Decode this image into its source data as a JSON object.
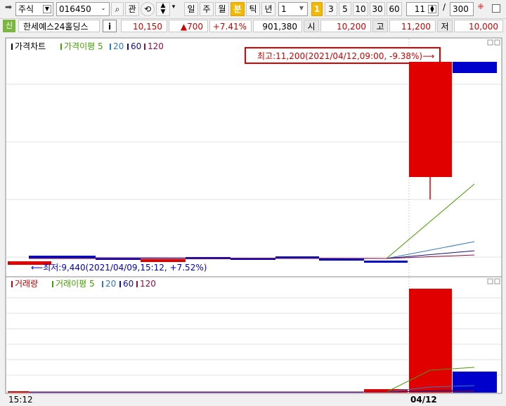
{
  "toolbar": {
    "market_type": "주식",
    "code": "016450",
    "btn_watch": "관",
    "periods": [
      "일",
      "주",
      "월",
      "분",
      "틱",
      "년"
    ],
    "selected_period": "분",
    "interval": "1",
    "intervals": [
      "1",
      "3",
      "5",
      "10",
      "30",
      "60"
    ],
    "selected_interval": "1",
    "zoom_value": "11",
    "zoom_sep": "/",
    "zoom_total": "300"
  },
  "quote": {
    "badge": "신",
    "name": "한세예스24홀딩스",
    "info_btn": "i",
    "price": "10,150",
    "change": "▲700",
    "change_pct": "+7.41%",
    "volume": "901,380",
    "open_label": "시",
    "open": "10,200",
    "high_label": "고",
    "high": "11,200",
    "low_label": "저",
    "low": "10,000"
  },
  "price_panel": {
    "legend": [
      {
        "text": "가격차트",
        "color": "#000000"
      },
      {
        "text": "가격이평 5",
        "color": "#44a000"
      },
      {
        "text": "20",
        "color": "#2f79c9"
      },
      {
        "text": "60",
        "color": "#10108c"
      },
      {
        "text": "120",
        "color": "#8c1040"
      }
    ],
    "high_note": "최고:11,200(2021/04/12,09:00, -9.38%)⟶",
    "low_note": "⟵최저:9,440(2021/04/09,15:12, +7.52%)"
  },
  "volume_panel": {
    "legend": [
      {
        "text": "거래량",
        "color": "#d00000"
      },
      {
        "text": "거래이평 5",
        "color": "#44a000"
      },
      {
        "text": "20",
        "color": "#2f79c9"
      },
      {
        "text": "60",
        "color": "#10108c"
      },
      {
        "text": "120",
        "color": "#8c1040"
      }
    ]
  },
  "x_axis": {
    "left_label": "15:12",
    "day_label": "04/12"
  },
  "colors": {
    "up": "#e00000",
    "down": "#0000cc",
    "ma5": "#44a000",
    "ma20": "#2f79c9",
    "ma60": "#10108c",
    "ma120": "#8c1040"
  }
}
